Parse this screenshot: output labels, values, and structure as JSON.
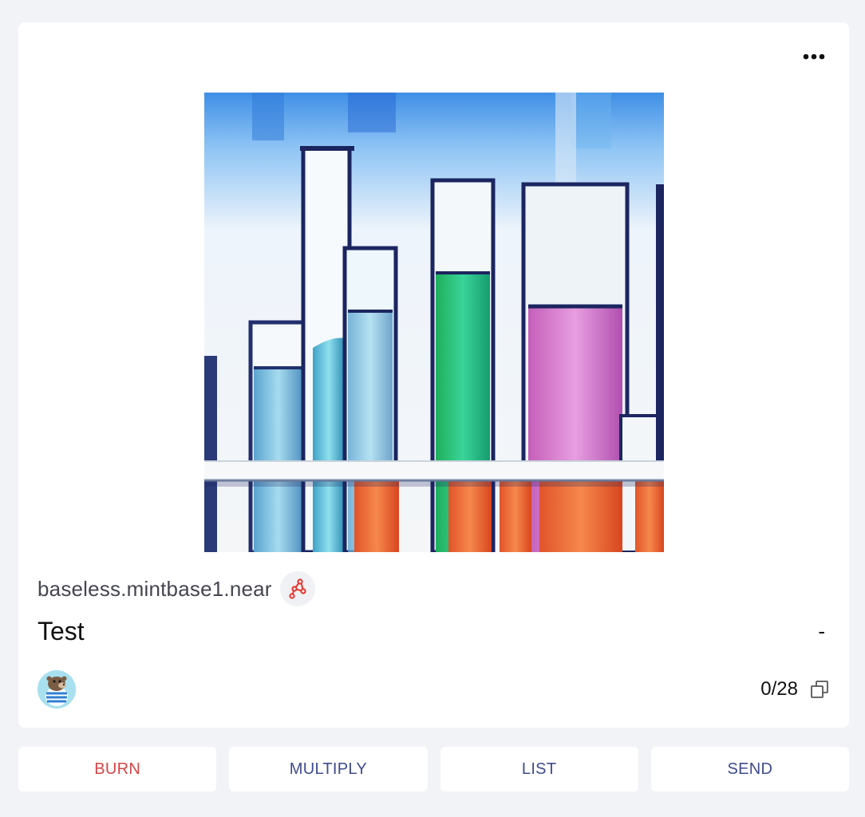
{
  "card": {
    "menu_icon": "more-horizontal-icon",
    "image": {
      "description_icon": "test-tubes-image"
    },
    "store": {
      "name": "baseless.mintbase1.near",
      "badge_icon": "store-network-icon",
      "badge_color": "#e8322b"
    },
    "nft": {
      "title": "Test",
      "price": "-"
    },
    "owner": {
      "avatar_icon": "bear-avatar-icon"
    },
    "supply": {
      "text": "0/28",
      "icon": "copies-icon"
    }
  },
  "actions": [
    {
      "label": "BURN",
      "color": "#d64545"
    },
    {
      "label": "MULTIPLY",
      "color": "#3e4b8e"
    },
    {
      "label": "LIST",
      "color": "#3e4b8e"
    },
    {
      "label": "SEND",
      "color": "#3e4b8e"
    }
  ],
  "colors": {
    "background": "#f2f3f7",
    "card": "#ffffff",
    "danger": "#d64545",
    "primary_text": "#3e4b8e"
  }
}
